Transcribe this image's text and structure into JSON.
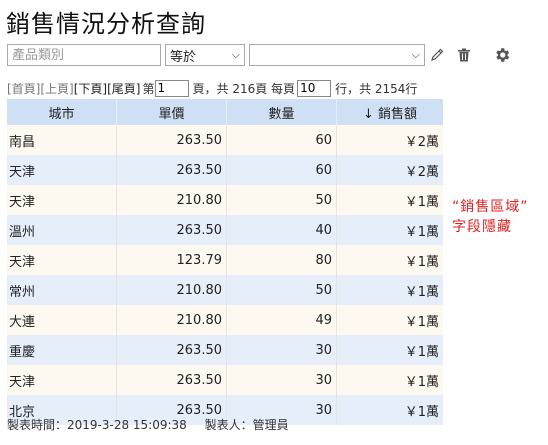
{
  "title": "銷售情況分析查詢",
  "filter": {
    "field_placeholder": "產品類別",
    "operator": "等於",
    "value": ""
  },
  "pager": {
    "first": "[首頁]",
    "prev": "[上頁]",
    "next": "[下頁]",
    "last": "[尾頁]",
    "page_prefix": "第",
    "page": "1",
    "page_suffix": "頁，共 216頁 每頁",
    "per_page": "10",
    "total_text": "行，共 2154行"
  },
  "table": {
    "headers": {
      "city": "城市",
      "price": "單價",
      "qty": "數量",
      "sales": "↓ 銷售額"
    },
    "rows": [
      {
        "city": "南昌",
        "price": "263.50",
        "qty": "60",
        "sales": "￥2萬"
      },
      {
        "city": "天津",
        "price": "263.50",
        "qty": "60",
        "sales": "￥2萬"
      },
      {
        "city": "天津",
        "price": "210.80",
        "qty": "50",
        "sales": "￥1萬"
      },
      {
        "city": "溫州",
        "price": "263.50",
        "qty": "40",
        "sales": "￥1萬"
      },
      {
        "city": "天津",
        "price": "123.79",
        "qty": "80",
        "sales": "￥1萬"
      },
      {
        "city": "常州",
        "price": "210.80",
        "qty": "50",
        "sales": "￥1萬"
      },
      {
        "city": "大連",
        "price": "210.80",
        "qty": "49",
        "sales": "￥1萬"
      },
      {
        "city": "重慶",
        "price": "263.50",
        "qty": "30",
        "sales": "￥1萬"
      },
      {
        "city": "天津",
        "price": "263.50",
        "qty": "30",
        "sales": "￥1萬"
      },
      {
        "city": "北京",
        "price": "263.50",
        "qty": "30",
        "sales": "￥1萬"
      }
    ]
  },
  "note": {
    "line1": "“銷售區域”",
    "line2": "字段隱藏"
  },
  "footer": {
    "time_label": "製表時間：2019-3-28 15:09:38",
    "maker_label": "製表人：管理員"
  },
  "icons": {
    "edit": "pencil-icon",
    "delete": "trash-icon",
    "settings": "gear-icon"
  },
  "colors": {
    "header_bg": "#cfe0f4",
    "odd_row": "#fdf8f0",
    "even_row": "#e6eefa",
    "note": "#e02020"
  }
}
